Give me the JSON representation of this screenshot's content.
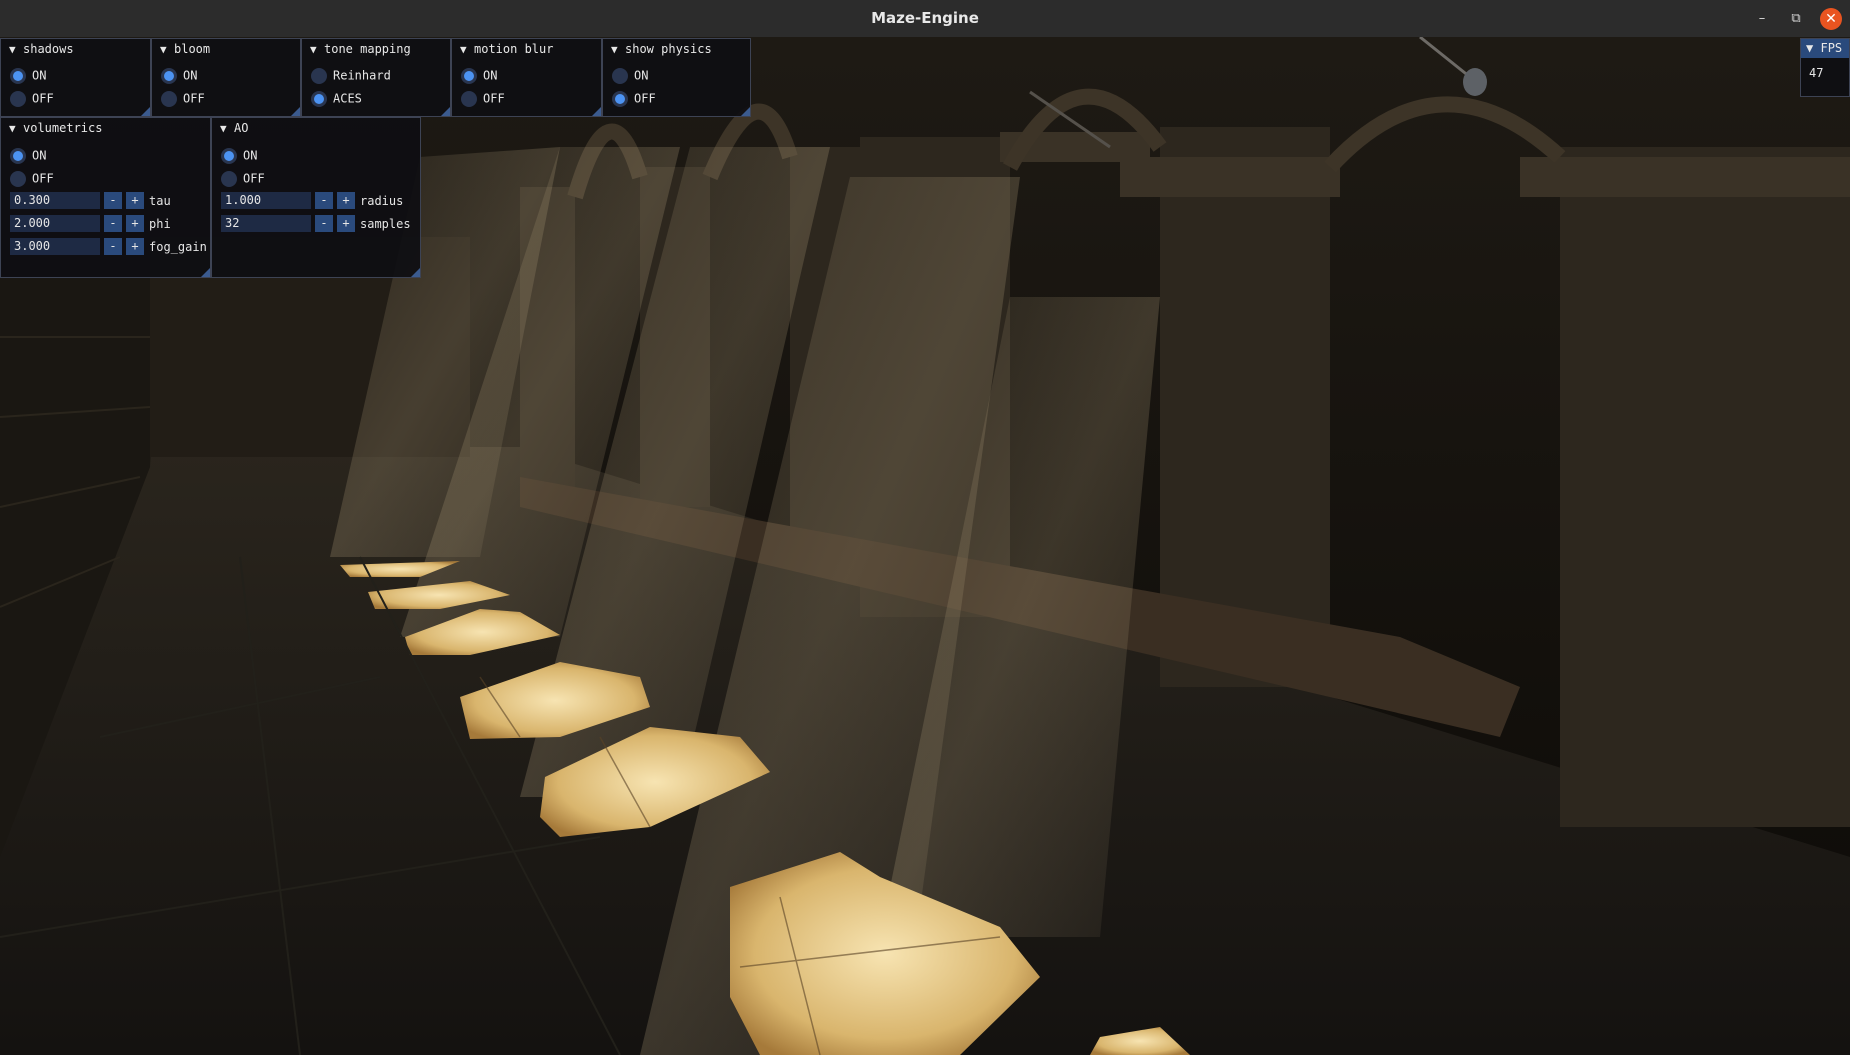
{
  "window": {
    "title": "Maze-Engine"
  },
  "icons": {
    "minimize": "minimize-icon",
    "maximize": "restore-icon",
    "close": "close-icon",
    "collapse": "collapse-triangle-icon"
  },
  "colors": {
    "accent": "#4c93f2",
    "close": "#e95420",
    "panel_border": "#3d4354"
  },
  "panels": {
    "shadows": {
      "title": "shadows",
      "options": [
        "ON",
        "OFF"
      ],
      "selected": "ON"
    },
    "bloom": {
      "title": "bloom",
      "options": [
        "ON",
        "OFF"
      ],
      "selected": "ON"
    },
    "tone_mapping": {
      "title": "tone mapping",
      "options": [
        "Reinhard",
        "ACES"
      ],
      "selected": "ACES"
    },
    "motion_blur": {
      "title": "motion blur",
      "options": [
        "ON",
        "OFF"
      ],
      "selected": "ON"
    },
    "show_physics": {
      "title": "show physics",
      "options": [
        "ON",
        "OFF"
      ],
      "selected": "OFF"
    },
    "volumetrics": {
      "title": "volumetrics",
      "options": [
        "ON",
        "OFF"
      ],
      "selected": "ON",
      "params": [
        {
          "value": "0.300",
          "label": "tau"
        },
        {
          "value": "2.000",
          "label": "phi"
        },
        {
          "value": "3.000",
          "label": "fog_gain"
        }
      ]
    },
    "ao": {
      "title": "AO",
      "options": [
        "ON",
        "OFF"
      ],
      "selected": "ON",
      "params": [
        {
          "value": "1.000",
          "label": "radius"
        },
        {
          "value": "32",
          "label": "samples"
        }
      ]
    }
  },
  "stepper": {
    "minus": "-",
    "plus": "+"
  },
  "fps": {
    "title": "FPS",
    "value": "47"
  }
}
